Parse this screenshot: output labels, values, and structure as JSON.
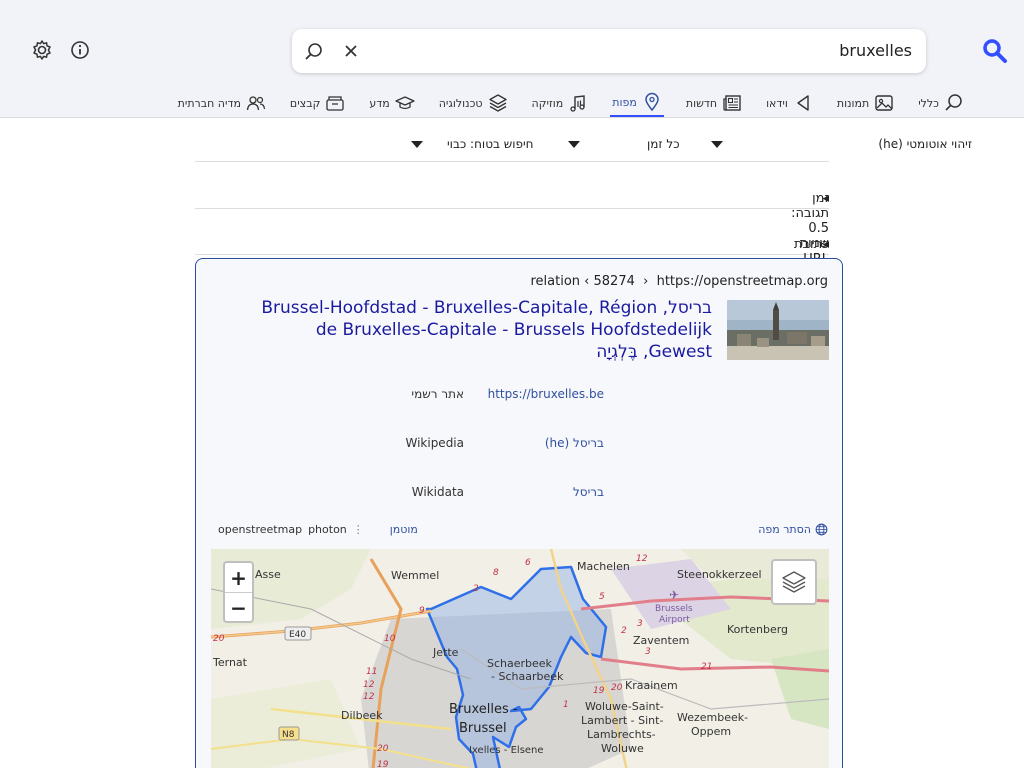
{
  "search": {
    "value": "bruxelles"
  },
  "tabs": [
    {
      "label": "כללי",
      "icon": "search-icon",
      "active": false
    },
    {
      "label": "תמונות",
      "icon": "image-icon",
      "active": false
    },
    {
      "label": "וידאו",
      "icon": "video-icon",
      "active": false
    },
    {
      "label": "חדשות",
      "icon": "news-icon",
      "active": false
    },
    {
      "label": "מפות",
      "icon": "map-pin-icon",
      "active": true
    },
    {
      "label": "מוזיקה",
      "icon": "music-icon",
      "active": false
    },
    {
      "label": "טכנולוגיה",
      "icon": "layers-icon",
      "active": false
    },
    {
      "label": "מדע",
      "icon": "science-icon",
      "active": false
    },
    {
      "label": "קבצים",
      "icon": "files-icon",
      "active": false
    },
    {
      "label": "מדיה חברתית",
      "icon": "people-icon",
      "active": false
    }
  ],
  "filters": {
    "language": "זיהוי אוטומטי (he)",
    "time": "כל זמן",
    "safe_search": "חיפוש בטוח: כבוי"
  },
  "response_time": "זמן תגובה: 0.5 שניות",
  "search_url": "כתובת URL חיפוש",
  "infobox": {
    "url_host": "https://openstreetmap.org",
    "url_sep1": "›",
    "url_id": "58274",
    "url_sep2": "‹",
    "url_type": "relation",
    "title": "בריסל, Brussel-Hoofdstad - Bruxelles-Capitale, Région de Bruxelles-Capitale - Brussels Hoofdstedelijk Gewest, בֶּלְגְיָה",
    "rows": [
      {
        "key": "אתר רשמי",
        "value": "https://bruxelles.be"
      },
      {
        "key": "Wikipedia",
        "value": "בריסל (he)"
      },
      {
        "key": "Wikidata",
        "value": "בריסל"
      }
    ],
    "hide_map": "הסתר מפה",
    "map_sources": {
      "selected": "מוטמן",
      "a": "photon",
      "b": "openstreetmap"
    }
  },
  "map": {
    "zoom_in": "+",
    "zoom_out": "−",
    "labels": [
      "Asse",
      "Wemmel",
      "Machelen",
      "Steenokkerzeel",
      "Brussels Airport",
      "Zaventem",
      "Kortenberg",
      "Ternat",
      "Jette",
      "Schaerbeek - Schaarbeek",
      "Kraainem",
      "Dilbeek",
      "Bruxelles - Brussel",
      "Woluwe-Saint-Lambert - Sint-Lambrechts-Woluwe",
      "Wezembeek-Oppem",
      "Ixelles - Elsene",
      "E40",
      "N8"
    ],
    "colors": {
      "boundary": "#2f6fe8",
      "fill": "#8fb0e8",
      "accent": "#3050ff"
    }
  }
}
